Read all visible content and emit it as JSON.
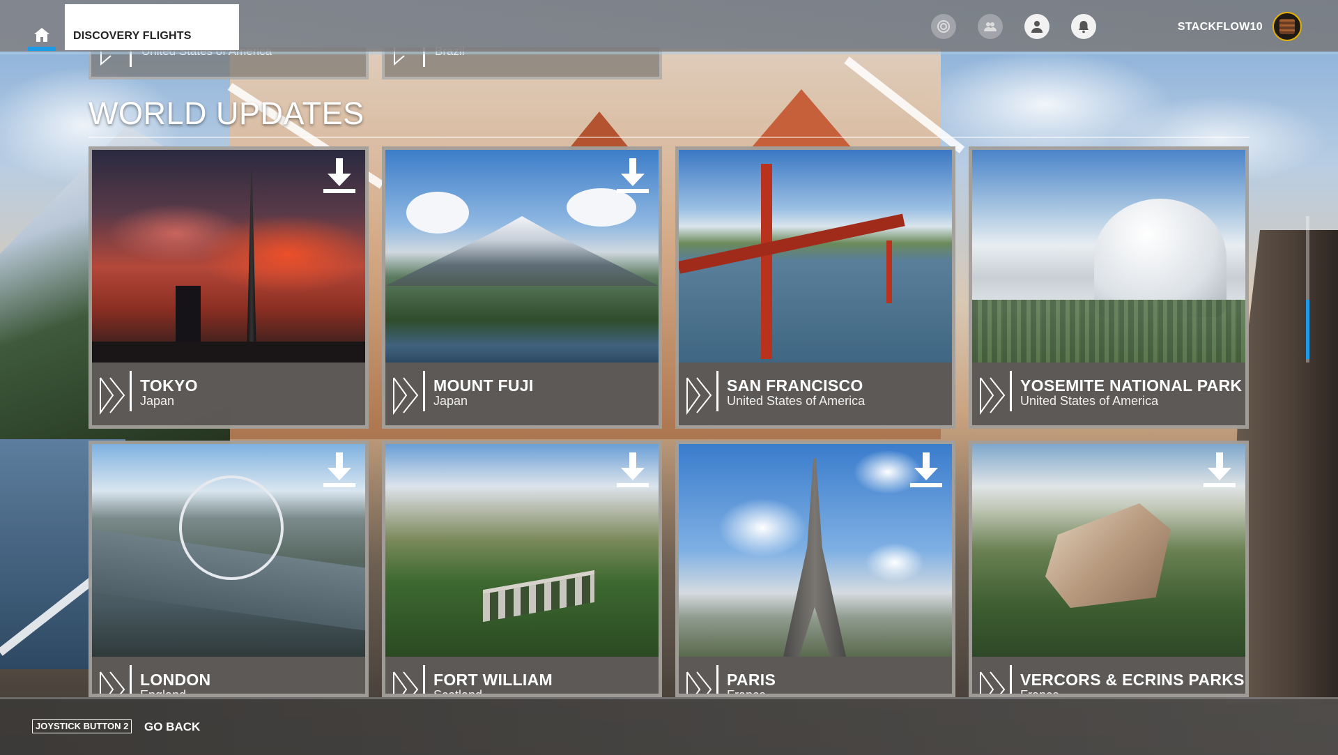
{
  "topbar": {
    "active_tab": "DISCOVERY FLIGHTS",
    "username": "STACKFLOW10",
    "icons": [
      "home-icon",
      "rewards-icon",
      "friends-icon",
      "profile-icon",
      "notifications-icon"
    ]
  },
  "previous_section": {
    "cards": [
      {
        "country": "United States of America"
      },
      {
        "country": "Brazil"
      }
    ]
  },
  "section": {
    "title": "WORLD UPDATES"
  },
  "cards": [
    {
      "name": "TOKYO",
      "country": "Japan"
    },
    {
      "name": "MOUNT FUJI",
      "country": "Japan"
    },
    {
      "name": "SAN FRANCISCO",
      "country": "United States of America"
    },
    {
      "name": "YOSEMITE NATIONAL PARK",
      "country": "United States of America"
    },
    {
      "name": "LONDON",
      "country": "England"
    },
    {
      "name": "FORT WILLIAM",
      "country": "Scotland"
    },
    {
      "name": "PARIS",
      "country": "France"
    },
    {
      "name": "VERCORS & ECRINS PARKS",
      "country": "France"
    }
  ],
  "footer": {
    "key_label": "JOYSTICK BUTTON 2",
    "action_label": "GO BACK"
  },
  "colors": {
    "accent": "#1c9ce8",
    "avatar_ring": "#e6b200"
  }
}
